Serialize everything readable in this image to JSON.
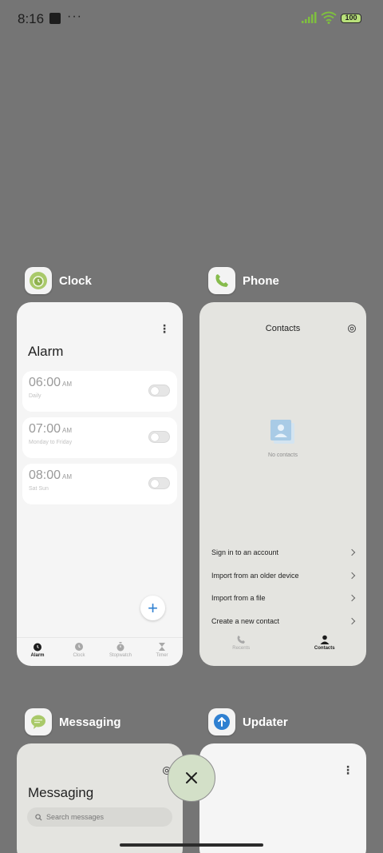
{
  "status_bar": {
    "time": "8:16",
    "overflow": "···",
    "battery": "100"
  },
  "apps": {
    "clock": {
      "name": "Clock",
      "title": "Alarm",
      "alarms": [
        {
          "time": "06:00",
          "ampm": "AM",
          "repeat": "Daily"
        },
        {
          "time": "07:00",
          "ampm": "AM",
          "repeat": "Monday to Friday"
        },
        {
          "time": "08:00",
          "ampm": "AM",
          "repeat": "Sat Sun"
        }
      ],
      "add_label": "+",
      "nav": [
        "Alarm",
        "Clock",
        "Stopwatch",
        "Timer"
      ]
    },
    "phone": {
      "name": "Phone",
      "title": "Contacts",
      "empty_text": "No contacts",
      "actions": [
        "Sign in to an account",
        "Import from an older device",
        "Import from a file",
        "Create a new contact"
      ],
      "nav": [
        "Recents",
        "Contacts"
      ]
    },
    "messaging": {
      "name": "Messaging",
      "title": "Messaging",
      "search_placeholder": "Search messages"
    },
    "updater": {
      "name": "Updater"
    }
  },
  "colors": {
    "background": "#757575",
    "accent_blue": "#2f80d1",
    "close_button": "#d3e0c8"
  },
  "icons": {
    "clock_app": "alarm-clock-icon",
    "phone_app": "phone-handset-icon",
    "messaging_app": "chat-bubble-icon",
    "updater_app": "arrow-up-circle-icon",
    "close": "close-x-icon"
  }
}
